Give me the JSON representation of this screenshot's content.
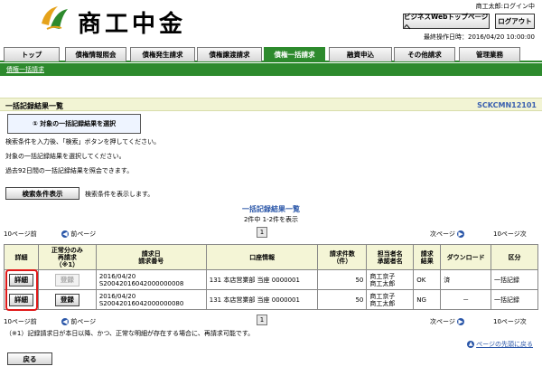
{
  "header": {
    "logo_text": "商工中金",
    "user": "商工太郎:ログイン中",
    "top_page_button": "ビジネスWebトップページへ",
    "logout_button": "ログアウト",
    "last_operation": "最終操作日時：2016/04/20 10:00:00"
  },
  "tabs": [
    {
      "label": "トップ"
    },
    {
      "label": "債権情報照会"
    },
    {
      "label": "債権発生請求"
    },
    {
      "label": "債権譲渡請求"
    },
    {
      "label": "債権一括請求"
    },
    {
      "label": "融資申込"
    },
    {
      "label": "その他請求"
    },
    {
      "label": "管理業務"
    }
  ],
  "subnav": {
    "link": "債権一括請求"
  },
  "page": {
    "title": "一括記録結果一覧",
    "screen_id": "SCKCMN12101",
    "step_label": "① 対象の一括記録結果を選択",
    "instructions": [
      "検索条件を入力後、「検索」ボタンを押してください。",
      "対象の一括記録結果を選択してください。",
      "過去92日間の一括記録結果を照会できます。"
    ],
    "search_toggle_button": "検索条件表示",
    "search_toggle_hint": "検索条件を表示します。",
    "list_title": "一括記録結果一覧",
    "list_info": "2件中 1-2件を表示"
  },
  "pager": {
    "prev10": "10ページ前",
    "prev": "前ページ",
    "page": "1",
    "next": "次ページ",
    "next10": "10ページ次"
  },
  "table": {
    "headers": {
      "detail": "詳細",
      "normal_rerequest": "正常分のみ\n再請求\n（※1）",
      "request": "請求日\n請求番号",
      "account": "口座情報",
      "count": "請求件数\n（件）",
      "person": "担当者名\n承認者名",
      "result": "請求\n結果",
      "download": "ダウンロード",
      "category": "区分"
    },
    "rows": [
      {
        "detail_button": "詳細",
        "register_button": "登録",
        "request_date": "2016/04/20",
        "request_no": "S20042016042000000008",
        "account": "131 本店営業部 当座 0000001",
        "count": "50",
        "person": "商工京子",
        "approver": "商工太郎",
        "result": "OK",
        "download": "済",
        "category": "一括記録"
      },
      {
        "detail_button": "詳細",
        "register_button": "登録",
        "request_date": "2016/04/20",
        "request_no": "S20042016042000000080",
        "account": "131 本店営業部 当座 0000001",
        "count": "50",
        "person": "商工京子",
        "approver": "商工太郎",
        "result": "NG",
        "download": "－",
        "category": "一括記録"
      }
    ]
  },
  "footer": {
    "note": "（※1）記録請求日が本日以降、かつ、正常な明細が存在する場合に、再請求可能です。",
    "to_top": "ページの先頭に戻る",
    "back_button": "戻る"
  }
}
